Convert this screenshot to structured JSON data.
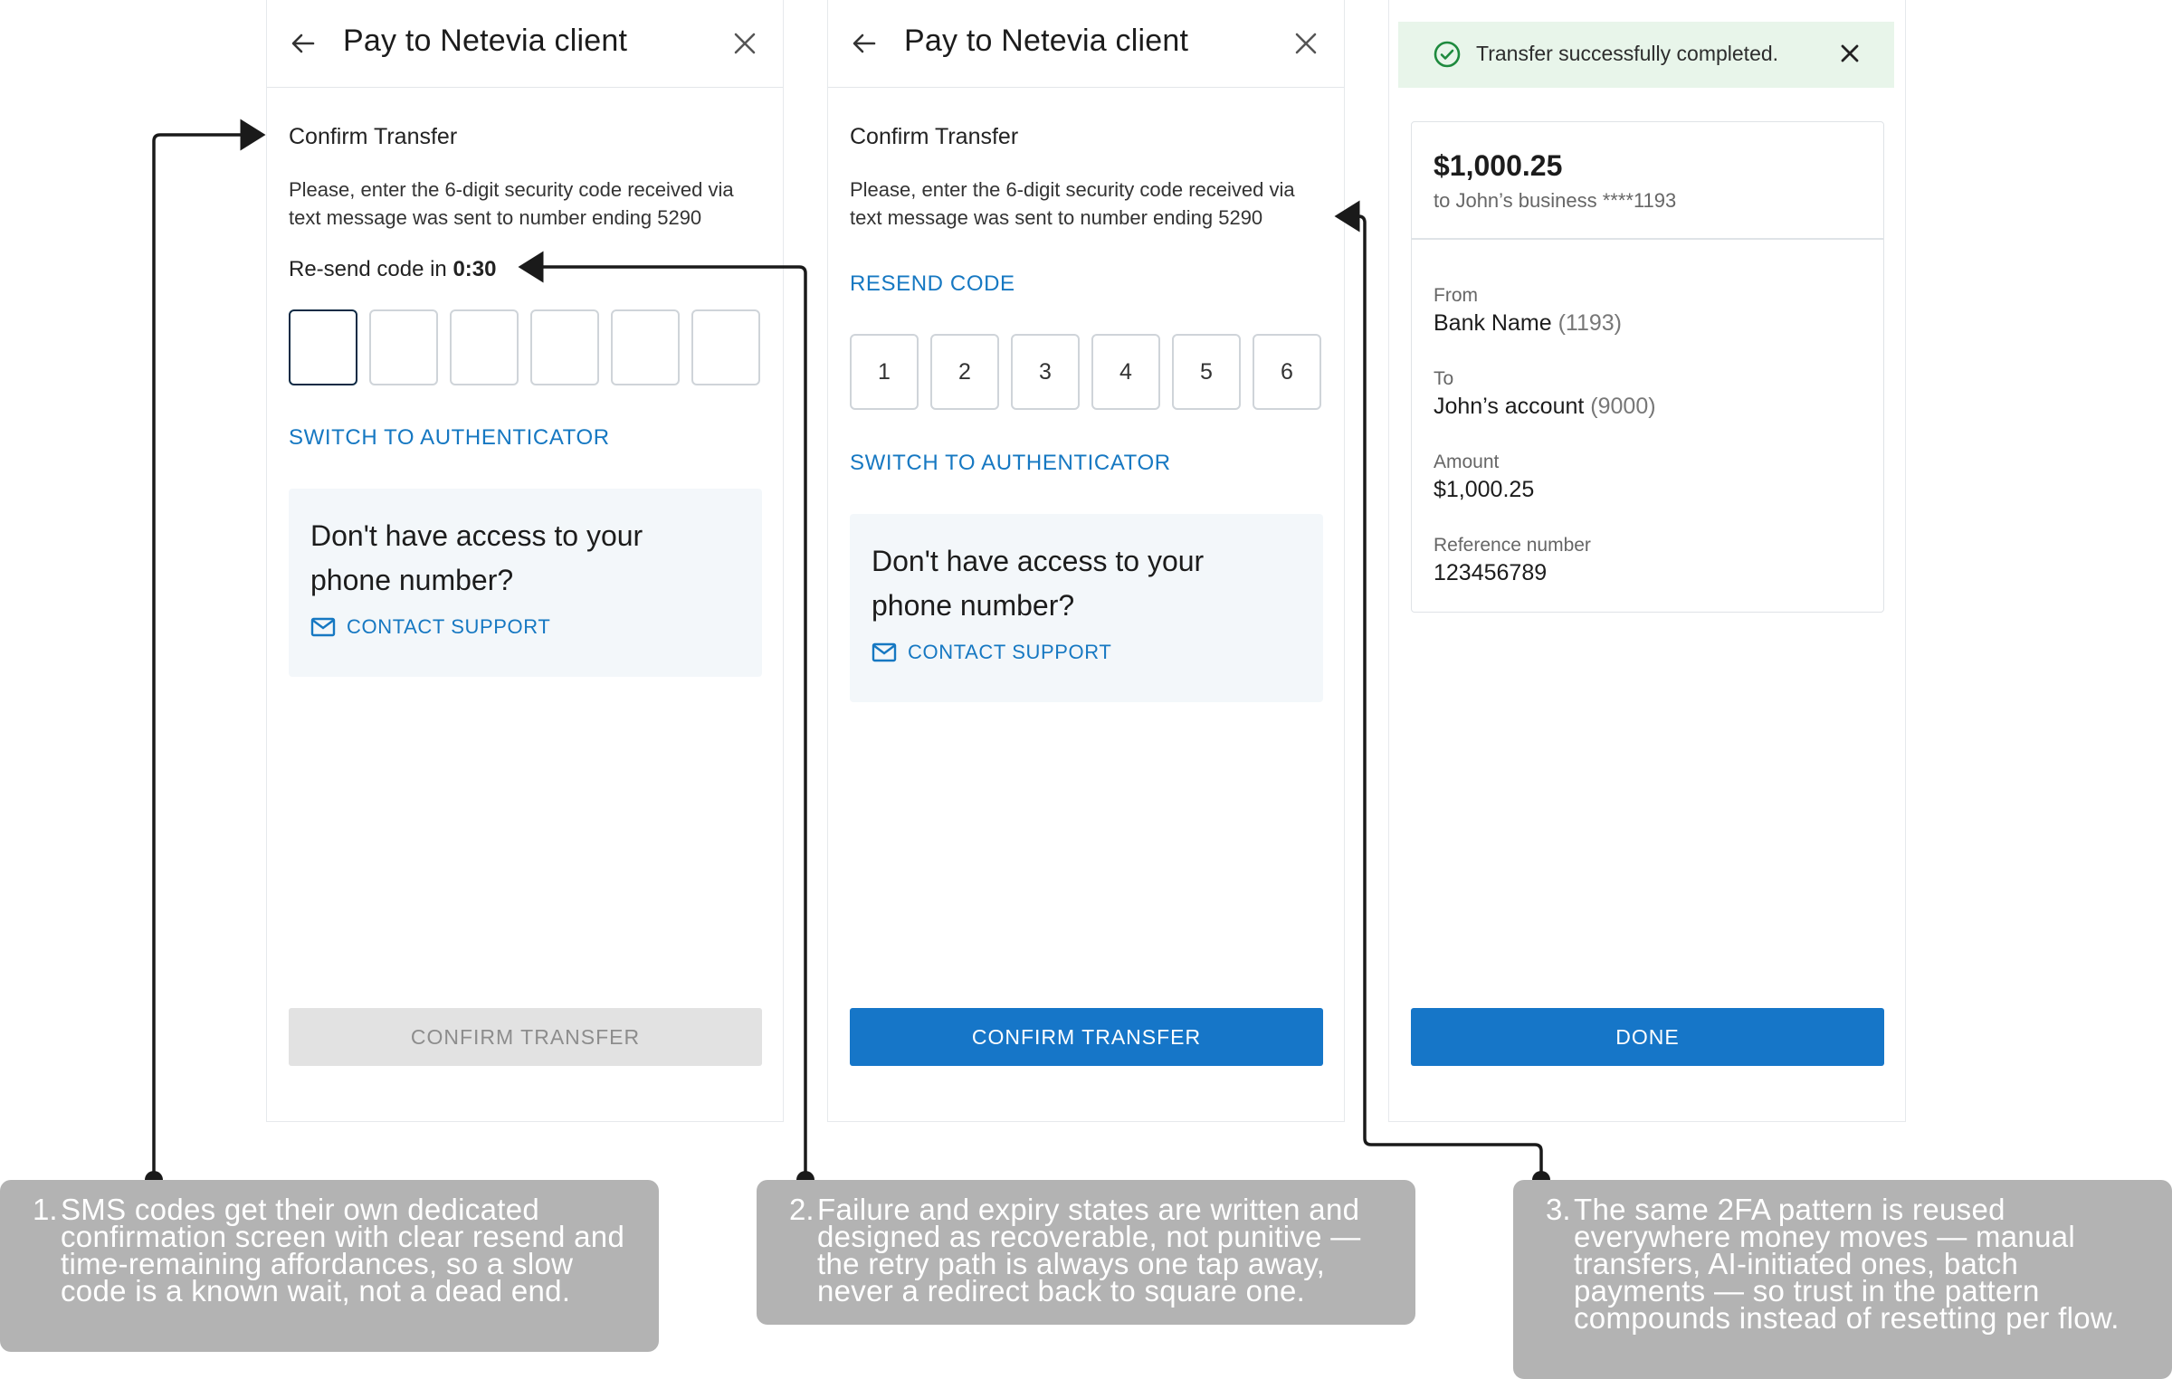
{
  "screens": [
    {
      "header_title": "Pay to Netevia client",
      "section_title": "Confirm Transfer",
      "description": "Please, enter the 6-digit security code received via text message was sent to number ending 5290",
      "resend_prefix": "Re-send code in ",
      "resend_timer": "0:30",
      "code_digits": [
        "",
        "",
        "",
        "",
        "",
        ""
      ],
      "switch_label": "SWITCH TO AUTHENTICATOR",
      "support_question": "Don't have access to your phone number?",
      "support_link": "CONTACT SUPPORT",
      "button_label": "CONFIRM TRANSFER",
      "button_state": "disabled"
    },
    {
      "header_title": "Pay to Netevia client",
      "section_title": "Confirm Transfer",
      "description": "Please, enter the 6-digit security code received via text message was sent to number ending 5290",
      "resend_link": "RESEND CODE",
      "code_digits": [
        "1",
        "2",
        "3",
        "4",
        "5",
        "6"
      ],
      "switch_label": "SWITCH TO AUTHENTICATOR",
      "support_question": "Don't have access to your phone number?",
      "support_link": "CONTACT SUPPORT",
      "button_label": "CONFIRM TRANSFER",
      "button_state": "enabled"
    },
    {
      "toast_text": "Transfer successfully completed.",
      "amount": "$1,000.25",
      "to_line": "to John’s business ****1193",
      "from_label": "From",
      "from_value": "Bank Name",
      "from_suffix": "(1193)",
      "to_label": "To",
      "to_value": "John’s account",
      "to_suffix": "(9000)",
      "amount_label": "Amount",
      "amount_value": "$1,000.25",
      "ref_label": "Reference number",
      "ref_value": "123456789",
      "button_label": "DONE"
    }
  ],
  "annotations": [
    {
      "number": "1.",
      "text": "SMS codes get their own dedicated confirmation screen with clear resend and time-remaining affordances, so a slow code is a known wait, not a dead end."
    },
    {
      "number": "2.",
      "text": "Failure and expiry states are written and designed as recoverable, not punitive — the retry path is always one tap away, never a redirect back to square one."
    },
    {
      "number": "3.",
      "text": "The same 2FA pattern is reused everywhere money moves — manual transfers, AI-initiated ones, batch payments — so trust in the pattern compounds instead of resetting per flow."
    }
  ],
  "colors": {
    "accent": "#1676c8",
    "link": "#1678c2",
    "success_bg": "#e8f5ea",
    "success_icon": "#1e8a3e",
    "note_bg": "#b3b3b3",
    "active_box": "#0f2b45"
  },
  "icons": [
    "arrow-left-icon",
    "close-icon",
    "mail-icon",
    "check-circle-icon"
  ]
}
